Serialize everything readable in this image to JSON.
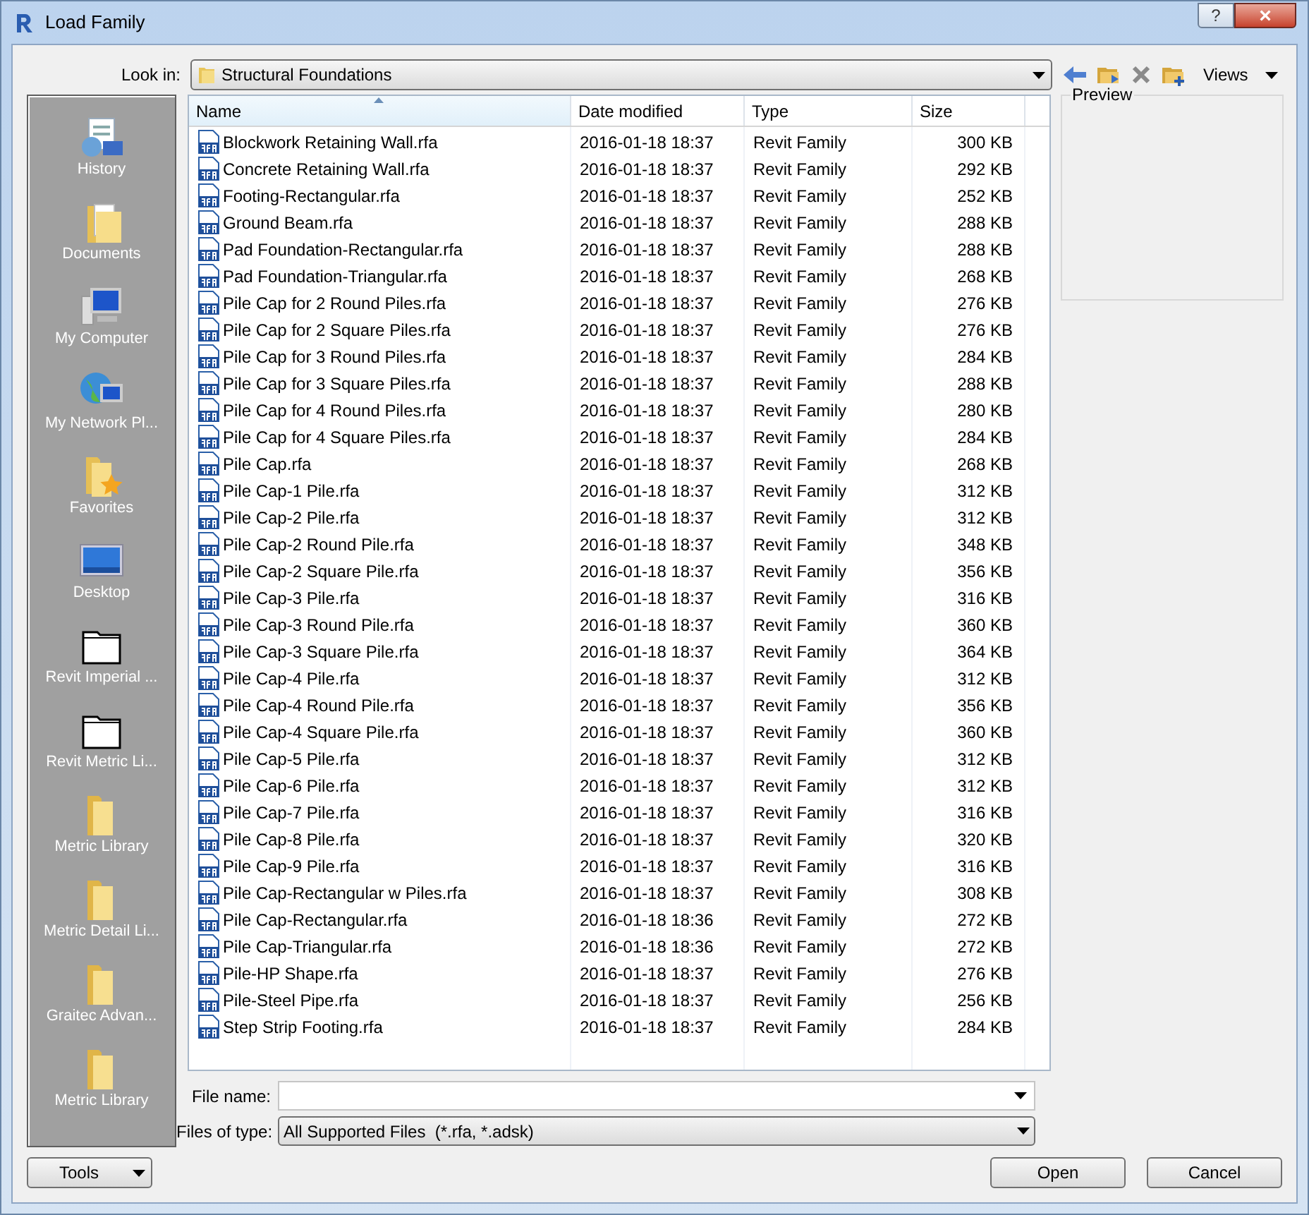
{
  "window": {
    "title": "Load Family",
    "help": "?",
    "close": "×"
  },
  "look_in": {
    "label": "Look in:",
    "value": "Structural Foundations"
  },
  "toolbar": {
    "views": "Views"
  },
  "places": [
    {
      "label": "History",
      "kind": "history"
    },
    {
      "label": "Documents",
      "kind": "documents"
    },
    {
      "label": "My Computer",
      "kind": "computer"
    },
    {
      "label": "My Network Pl...",
      "kind": "network"
    },
    {
      "label": "Favorites",
      "kind": "favorites"
    },
    {
      "label": "Desktop",
      "kind": "desktop"
    },
    {
      "label": "Revit Imperial ...",
      "kind": "plain-folder"
    },
    {
      "label": "Revit Metric Li...",
      "kind": "plain-folder"
    },
    {
      "label": "Metric Library",
      "kind": "folder"
    },
    {
      "label": "Metric Detail Li...",
      "kind": "folder"
    },
    {
      "label": "Graitec Advan...",
      "kind": "folder"
    },
    {
      "label": "Metric Library",
      "kind": "folder"
    }
  ],
  "table": {
    "columns": [
      {
        "label": "Name",
        "sorted": true
      },
      {
        "label": "Date modified",
        "sorted": false
      },
      {
        "label": "Type",
        "sorted": false
      },
      {
        "label": "Size",
        "sorted": false
      }
    ],
    "rows": [
      [
        "Blockwork Retaining Wall.rfa",
        "2016-01-18 18:37",
        "Revit Family",
        "300 KB"
      ],
      [
        "Concrete Retaining Wall.rfa",
        "2016-01-18 18:37",
        "Revit Family",
        "292 KB"
      ],
      [
        "Footing-Rectangular.rfa",
        "2016-01-18 18:37",
        "Revit Family",
        "252 KB"
      ],
      [
        "Ground Beam.rfa",
        "2016-01-18 18:37",
        "Revit Family",
        "288 KB"
      ],
      [
        "Pad Foundation-Rectangular.rfa",
        "2016-01-18 18:37",
        "Revit Family",
        "288 KB"
      ],
      [
        "Pad Foundation-Triangular.rfa",
        "2016-01-18 18:37",
        "Revit Family",
        "268 KB"
      ],
      [
        "Pile Cap for 2 Round Piles.rfa",
        "2016-01-18 18:37",
        "Revit Family",
        "276 KB"
      ],
      [
        "Pile Cap for 2 Square Piles.rfa",
        "2016-01-18 18:37",
        "Revit Family",
        "276 KB"
      ],
      [
        "Pile Cap for 3 Round Piles.rfa",
        "2016-01-18 18:37",
        "Revit Family",
        "284 KB"
      ],
      [
        "Pile Cap for 3 Square Piles.rfa",
        "2016-01-18 18:37",
        "Revit Family",
        "288 KB"
      ],
      [
        "Pile Cap for 4 Round Piles.rfa",
        "2016-01-18 18:37",
        "Revit Family",
        "280 KB"
      ],
      [
        "Pile Cap for 4 Square Piles.rfa",
        "2016-01-18 18:37",
        "Revit Family",
        "284 KB"
      ],
      [
        "Pile Cap.rfa",
        "2016-01-18 18:37",
        "Revit Family",
        "268 KB"
      ],
      [
        "Pile Cap-1 Pile.rfa",
        "2016-01-18 18:37",
        "Revit Family",
        "312 KB"
      ],
      [
        "Pile Cap-2 Pile.rfa",
        "2016-01-18 18:37",
        "Revit Family",
        "312 KB"
      ],
      [
        "Pile Cap-2 Round Pile.rfa",
        "2016-01-18 18:37",
        "Revit Family",
        "348 KB"
      ],
      [
        "Pile Cap-2 Square Pile.rfa",
        "2016-01-18 18:37",
        "Revit Family",
        "356 KB"
      ],
      [
        "Pile Cap-3 Pile.rfa",
        "2016-01-18 18:37",
        "Revit Family",
        "316 KB"
      ],
      [
        "Pile Cap-3 Round Pile.rfa",
        "2016-01-18 18:37",
        "Revit Family",
        "360 KB"
      ],
      [
        "Pile Cap-3 Square Pile.rfa",
        "2016-01-18 18:37",
        "Revit Family",
        "364 KB"
      ],
      [
        "Pile Cap-4 Pile.rfa",
        "2016-01-18 18:37",
        "Revit Family",
        "312 KB"
      ],
      [
        "Pile Cap-4 Round Pile.rfa",
        "2016-01-18 18:37",
        "Revit Family",
        "356 KB"
      ],
      [
        "Pile Cap-4 Square Pile.rfa",
        "2016-01-18 18:37",
        "Revit Family",
        "360 KB"
      ],
      [
        "Pile Cap-5 Pile.rfa",
        "2016-01-18 18:37",
        "Revit Family",
        "312 KB"
      ],
      [
        "Pile Cap-6 Pile.rfa",
        "2016-01-18 18:37",
        "Revit Family",
        "312 KB"
      ],
      [
        "Pile Cap-7 Pile.rfa",
        "2016-01-18 18:37",
        "Revit Family",
        "316 KB"
      ],
      [
        "Pile Cap-8 Pile.rfa",
        "2016-01-18 18:37",
        "Revit Family",
        "320 KB"
      ],
      [
        "Pile Cap-9 Pile.rfa",
        "2016-01-18 18:37",
        "Revit Family",
        "316 KB"
      ],
      [
        "Pile Cap-Rectangular w Piles.rfa",
        "2016-01-18 18:37",
        "Revit Family",
        "308 KB"
      ],
      [
        "Pile Cap-Rectangular.rfa",
        "2016-01-18 18:36",
        "Revit Family",
        "272 KB"
      ],
      [
        "Pile Cap-Triangular.rfa",
        "2016-01-18 18:36",
        "Revit Family",
        "272 KB"
      ],
      [
        "Pile-HP Shape.rfa",
        "2016-01-18 18:37",
        "Revit Family",
        "276 KB"
      ],
      [
        "Pile-Steel Pipe.rfa",
        "2016-01-18 18:37",
        "Revit Family",
        "256 KB"
      ],
      [
        "Step Strip Footing.rfa",
        "2016-01-18 18:37",
        "Revit Family",
        "284 KB"
      ]
    ]
  },
  "preview": {
    "label": "Preview"
  },
  "file_name": {
    "label": "File name:"
  },
  "files_of_type": {
    "label": "Files of type:",
    "value": "All Supported Files  (*.rfa, *.adsk)"
  },
  "buttons": {
    "tools": "Tools",
    "open": "Open",
    "cancel": "Cancel"
  }
}
